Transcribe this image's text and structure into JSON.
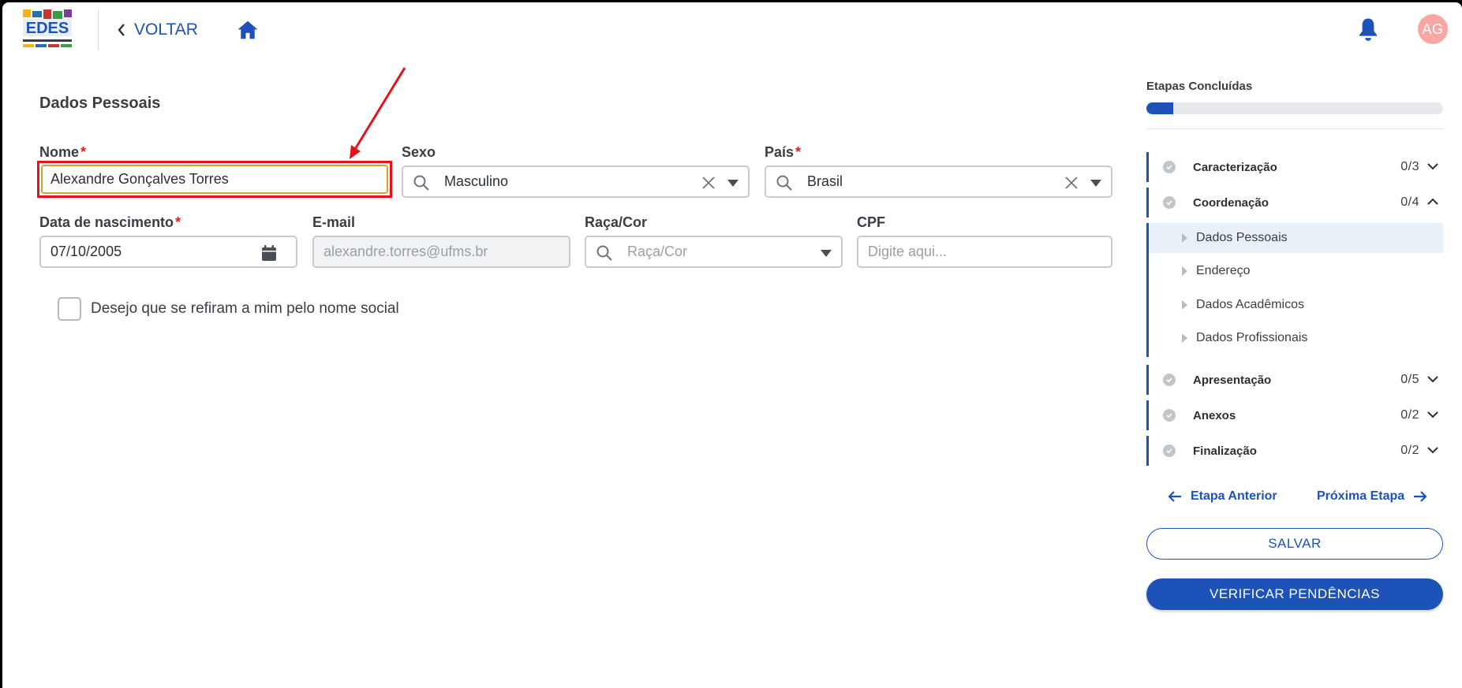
{
  "header": {
    "back_label": "VOLTAR",
    "avatar_initials": "AG",
    "logo_icon": "logo-icon",
    "home_icon": "home-icon",
    "bell_icon": "bell-icon"
  },
  "form": {
    "section_title": "Dados Pessoais",
    "required_mark": "*",
    "nome": {
      "label": "Nome",
      "value": "Alexandre Gonçalves Torres"
    },
    "sexo": {
      "label": "Sexo",
      "value": "Masculino"
    },
    "pais": {
      "label": "País",
      "value": "Brasil"
    },
    "nascimento": {
      "label": "Data de nascimento",
      "value": "07/10/2005"
    },
    "email": {
      "label": "E-mail",
      "placeholder": "alexandre.torres@ufms.br"
    },
    "raca": {
      "label": "Raça/Cor",
      "placeholder": "Raça/Cor"
    },
    "cpf": {
      "label": "CPF",
      "placeholder": "Digite aqui..."
    },
    "nome_social_label": "Desejo que se refiram a mim pelo nome social"
  },
  "sidebar": {
    "title": "Etapas Concluídas",
    "progress_fraction": 0.09,
    "steps": [
      {
        "label": "Caracterização",
        "count": "0/3",
        "expanded": false
      },
      {
        "label": "Coordenação",
        "count": "0/4",
        "expanded": true
      },
      {
        "label": "Apresentação",
        "count": "0/5",
        "expanded": false
      },
      {
        "label": "Anexos",
        "count": "0/2",
        "expanded": false
      },
      {
        "label": "Finalização",
        "count": "0/2",
        "expanded": false
      }
    ],
    "substeps": [
      {
        "label": "Dados Pessoais",
        "active": true
      },
      {
        "label": "Endereço",
        "active": false
      },
      {
        "label": "Dados Acadêmicos",
        "active": false
      },
      {
        "label": "Dados Profissionais",
        "active": false
      }
    ],
    "prev_label": "Etapa Anterior",
    "next_label": "Próxima Etapa",
    "save_label": "SALVAR",
    "verify_label": "VERIFICAR PENDÊNCIAS"
  },
  "colors": {
    "primary": "#1d52b8",
    "required": "#d9251c",
    "highlight": "#e4131b",
    "avatar": "#f8a7a4"
  }
}
